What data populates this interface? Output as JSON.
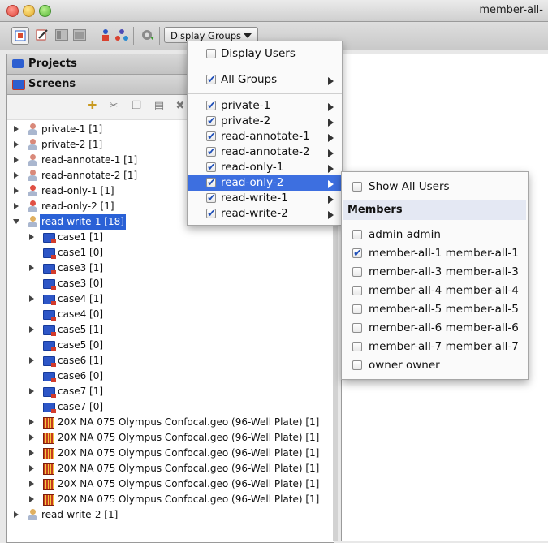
{
  "window": {
    "title": "member-all-"
  },
  "toolbar": {
    "display_groups_label": "Display Groups"
  },
  "sections": {
    "projects_label": "Projects",
    "screens_label": "Screens"
  },
  "tree": {
    "groups_before": [
      {
        "label": "private-1 [1]",
        "color": "#d9897a"
      },
      {
        "label": "private-2 [1]",
        "color": "#d9897a"
      },
      {
        "label": "read-annotate-1 [1]",
        "color": "#d9897a"
      },
      {
        "label": "read-annotate-2 [1]",
        "color": "#d9897a"
      },
      {
        "label": "read-only-1 [1]",
        "color": "#e05044"
      },
      {
        "label": "read-only-2 [1]",
        "color": "#e05044"
      }
    ],
    "expanded_group": {
      "label": "read-write-1 [18]"
    },
    "children": [
      {
        "label": "case1 [1]",
        "kind": "screen",
        "expandable": true
      },
      {
        "label": "case1 [0]",
        "kind": "screen",
        "expandable": false
      },
      {
        "label": "case3 [1]",
        "kind": "screen",
        "expandable": true
      },
      {
        "label": "case3 [0]",
        "kind": "screen",
        "expandable": false
      },
      {
        "label": "case4 [1]",
        "kind": "screen",
        "expandable": true
      },
      {
        "label": "case4 [0]",
        "kind": "screen",
        "expandable": false
      },
      {
        "label": "case5 [1]",
        "kind": "screen",
        "expandable": true
      },
      {
        "label": "case5 [0]",
        "kind": "screen",
        "expandable": false
      },
      {
        "label": "case6 [1]",
        "kind": "screen",
        "expandable": true
      },
      {
        "label": "case6 [0]",
        "kind": "screen",
        "expandable": false
      },
      {
        "label": "case7 [1]",
        "kind": "screen",
        "expandable": true
      },
      {
        "label": "case7 [0]",
        "kind": "screen",
        "expandable": false
      },
      {
        "label": "20X NA 075 Olympus Confocal.geo (96-Well Plate) [1]",
        "kind": "plate",
        "expandable": true
      },
      {
        "label": "20X NA 075 Olympus Confocal.geo (96-Well Plate) [1]",
        "kind": "plate",
        "expandable": true
      },
      {
        "label": "20X NA 075 Olympus Confocal.geo (96-Well Plate) [1]",
        "kind": "plate",
        "expandable": true
      },
      {
        "label": "20X NA 075 Olympus Confocal.geo (96-Well Plate) [1]",
        "kind": "plate",
        "expandable": true
      },
      {
        "label": "20X NA 075 Olympus Confocal.geo (96-Well Plate) [1]",
        "kind": "plate",
        "expandable": true
      },
      {
        "label": "20X NA 075 Olympus Confocal.geo (96-Well Plate) [1]",
        "kind": "plate",
        "expandable": true
      }
    ],
    "groups_after": [
      {
        "label": "read-write-2 [1]"
      }
    ]
  },
  "group_menu": {
    "display_users": {
      "label": "Display Users",
      "checked": false
    },
    "all_groups": {
      "label": "All Groups",
      "checked": true
    },
    "groups": [
      {
        "label": "private-1",
        "checked": true,
        "highlighted": false
      },
      {
        "label": "private-2",
        "checked": true,
        "highlighted": false
      },
      {
        "label": "read-annotate-1",
        "checked": true,
        "highlighted": false
      },
      {
        "label": "read-annotate-2",
        "checked": true,
        "highlighted": false
      },
      {
        "label": "read-only-1",
        "checked": true,
        "highlighted": false
      },
      {
        "label": "read-only-2",
        "checked": true,
        "highlighted": true
      },
      {
        "label": "read-write-1",
        "checked": true,
        "highlighted": false
      },
      {
        "label": "read-write-2",
        "checked": true,
        "highlighted": false
      }
    ]
  },
  "members_menu": {
    "show_all_users": {
      "label": "Show All Users",
      "checked": false
    },
    "header": "Members",
    "members": [
      {
        "label": "admin admin",
        "checked": false
      },
      {
        "label": "member-all-1 member-all-1",
        "checked": true
      },
      {
        "label": "member-all-3 member-all-3",
        "checked": false
      },
      {
        "label": "member-all-4 member-all-4",
        "checked": false
      },
      {
        "label": "member-all-5 member-all-5",
        "checked": false
      },
      {
        "label": "member-all-6 member-all-6",
        "checked": false
      },
      {
        "label": "member-all-7 member-all-7",
        "checked": false
      },
      {
        "label": "owner owner",
        "checked": false
      }
    ]
  }
}
